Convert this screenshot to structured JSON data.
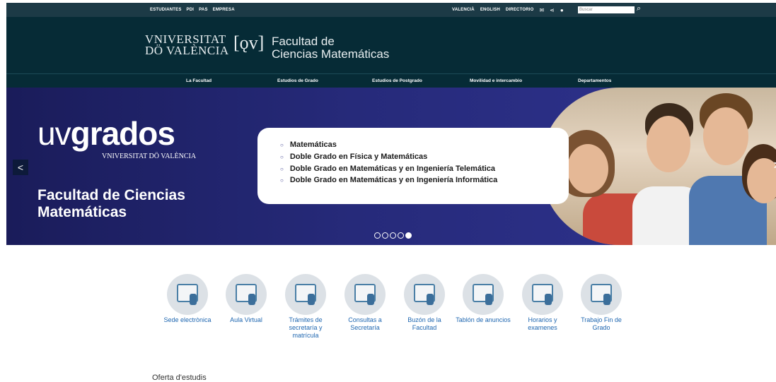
{
  "topbar": {
    "left_links": [
      "ESTUDIANTES",
      "PDI",
      "PAS",
      "EMPRESA"
    ],
    "right_links": [
      "VALENCIÀ",
      "ENGLISH",
      "DIRECTORIO"
    ],
    "search_placeholder": "Buscar",
    "icons": [
      "mail-icon",
      "share-icon",
      "user-icon",
      "search-icon"
    ]
  },
  "header": {
    "university_line1": "VNIVERSITAT",
    "university_line2": "DÖ VALÈNCIA",
    "emblem": "[ǫv]",
    "faculty_line1": "Facultad de",
    "faculty_line2": "Ciencias Matemáticas"
  },
  "nav": [
    "La Facultad",
    "Estudios de Grado",
    "Estudios de Postgrado",
    "Movilidad e intercambio",
    "Departamentos"
  ],
  "banner": {
    "brand_light": "uv",
    "brand_bold": "grados",
    "brand_sub": "VNIVERSITAT DÖ VALÈNCIA",
    "title_line1": "Facultad de Ciencias",
    "title_line2": "Matemáticas",
    "programs": [
      "Matemáticas",
      "Doble Grado en Física y Matemáticas",
      "Doble Grado en Matemáticas y en Ingeniería Telemática",
      "Doble Grado en Matemáticas y en Ingeniería Informática"
    ],
    "slides_total": 5,
    "slide_active": 5,
    "prev_label": "<",
    "next_label": ">"
  },
  "quick_links": [
    {
      "label": "Sede electrònica",
      "icon": "sede-icon"
    },
    {
      "label": "Aula Virtual",
      "icon": "aula-virtual-icon"
    },
    {
      "label": "Trámites de secretaría y matrícula",
      "icon": "tramites-icon"
    },
    {
      "label": "Consultas a Secretaría",
      "icon": "consultas-icon"
    },
    {
      "label": "Buzón de la Facultad",
      "icon": "buzon-icon"
    },
    {
      "label": "Tablón de anuncios",
      "icon": "tablon-icon"
    },
    {
      "label": "Horarios y examenes",
      "icon": "horarios-icon"
    },
    {
      "label": "Trabajo Fin de Grado",
      "icon": "tfg-icon"
    }
  ],
  "section_heading": "Oferta d'estudis",
  "colors": {
    "topbar": "#1c3a46",
    "header": "#062b36",
    "banner": "#2b2f86",
    "link": "#1e66b0"
  }
}
